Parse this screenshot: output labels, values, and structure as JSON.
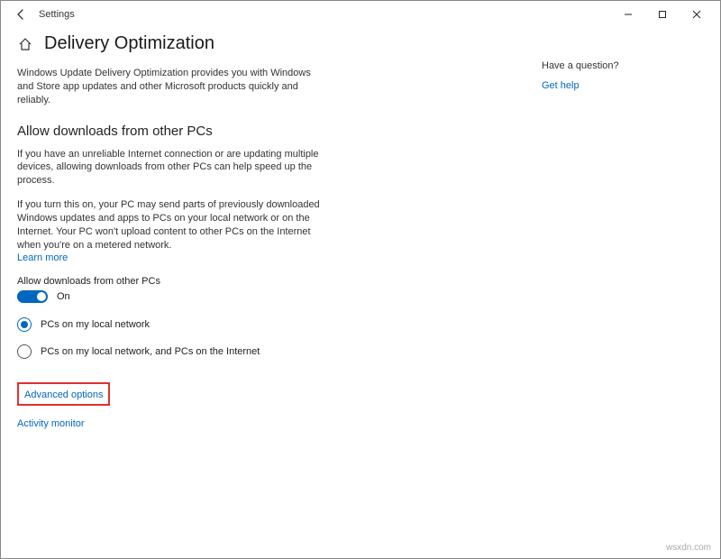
{
  "titlebar": {
    "app_name": "Settings"
  },
  "page": {
    "title": "Delivery Optimization",
    "intro": "Windows Update Delivery Optimization provides you with Windows and Store app updates and other Microsoft products quickly and reliably."
  },
  "section": {
    "heading": "Allow downloads from other PCs",
    "desc1": "If you have an unreliable Internet connection or are updating multiple devices, allowing downloads from other PCs can help speed up the process.",
    "desc2": "If you turn this on, your PC may send parts of previously downloaded Windows updates and apps to PCs on your local network or on the Internet. Your PC won't upload content to other PCs on the Internet when you're on a metered network.",
    "learn_more": "Learn more",
    "toggle_label": "Allow downloads from other PCs",
    "toggle_state": "On",
    "radio1": "PCs on my local network",
    "radio2": "PCs on my local network, and PCs on the Internet"
  },
  "links": {
    "advanced": "Advanced options",
    "activity": "Activity monitor"
  },
  "aside": {
    "question": "Have a question?",
    "get_help": "Get help"
  },
  "watermark": "wsxdn.com"
}
